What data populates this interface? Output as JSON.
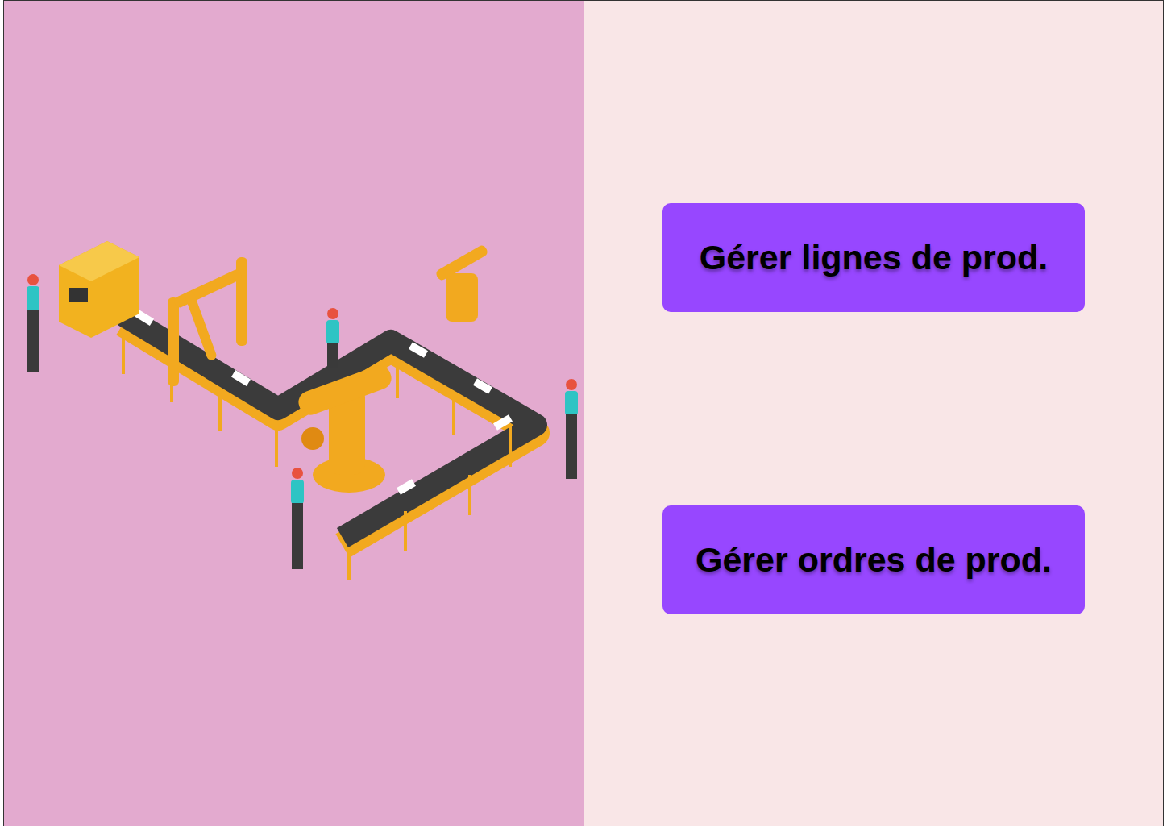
{
  "buttons": [
    {
      "label": "Gérer lignes de prod."
    },
    {
      "label": "Gérer ordres de prod."
    }
  ]
}
